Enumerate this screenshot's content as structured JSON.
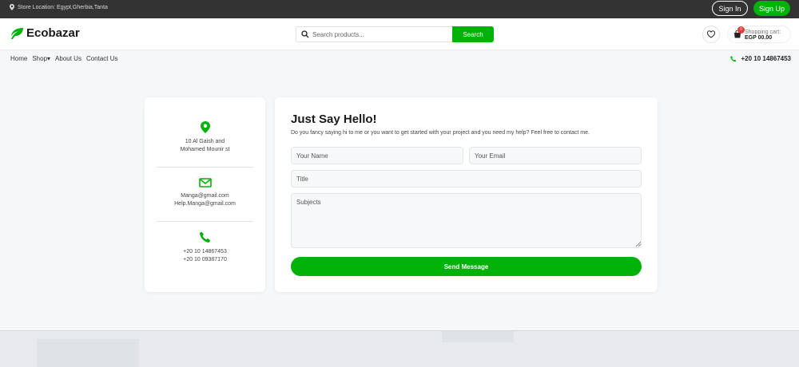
{
  "topbar": {
    "location": "Store Location: Egypt,Gherbia,Tanta",
    "sign_in": "Sign In",
    "sign_up": "Sign Up"
  },
  "header": {
    "logo": "Ecobazar",
    "search_placeholder": "Search products...",
    "search_button": "Search",
    "cart_count": "0",
    "cart_label": "Shopping cart:",
    "cart_total": "EGP 00.00"
  },
  "nav": {
    "items": [
      "Home",
      "Shop▾",
      "About Us",
      "Contact Us"
    ],
    "phone": "+20 10 14867453"
  },
  "info": {
    "address_line1": "10 Al Gaish and",
    "address_line2": "Mohamed Mounir st",
    "email1": "Manga@gmail.com",
    "email2": "Help.Manga@gmail.com",
    "phone1": "+20 10 14867453",
    "phone2": "+20 10 09387170"
  },
  "form": {
    "title": "Just Say Hello!",
    "subtitle": "Do you fancy saying hi to me or you want to get started with your project and you need my help? Feel free to contact me.",
    "name_placeholder": "Your Name",
    "email_placeholder": "Your Email",
    "title_placeholder": "Title",
    "subjects_placeholder": "Subjects",
    "send_button": "Send Message"
  },
  "colors": {
    "accent": "#00b207",
    "topbar": "#333333",
    "badge": "#e53935"
  },
  "icons": [
    "location-pin-icon",
    "leaf-logo-icon",
    "search-icon",
    "heart-icon",
    "bag-icon",
    "phone-icon",
    "envelope-icon"
  ]
}
